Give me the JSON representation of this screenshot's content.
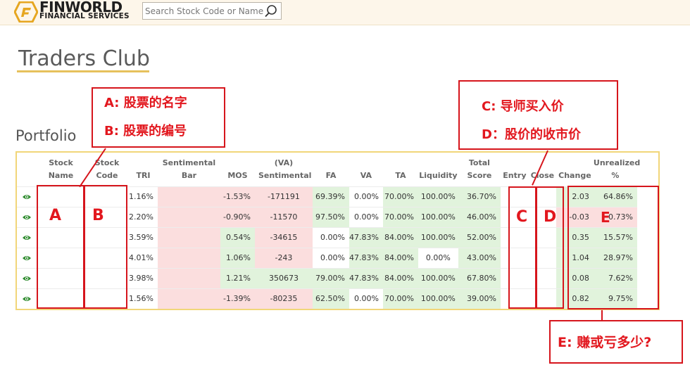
{
  "header": {
    "brand_name": "FINWORLD",
    "brand_sub": "FINANCIAL SERVICES",
    "search_placeholder": "Search Stock Code or Name",
    "logo_icon": "finworld-logo-icon",
    "search_icon": "search-icon"
  },
  "page_title": "Traders Club",
  "section_title": "Portfolio",
  "colors": {
    "accent": "#e6c15c",
    "negative_bg": "#fbdede",
    "positive_bg": "#e1f3dc",
    "annotation": "#e2171e",
    "eye": "#2e8b2e"
  },
  "table": {
    "columns": [
      "",
      "Stock Name",
      "Stock Code",
      "TRI",
      "Sentimental Bar",
      "MOS",
      "(VA) Sentimental",
      "FA",
      "VA",
      "TA",
      "Liquidity",
      "Total Score",
      "Entry",
      "Close",
      "Change",
      "Unrealized %"
    ],
    "rows": [
      {
        "tri": "1.16%",
        "mos": "-1.53%",
        "va_sent": "-171191",
        "fa": "69.39%",
        "va": "0.00%",
        "ta": "70.00%",
        "liq": "100.00%",
        "score": "36.70%",
        "change": "2.03",
        "unreal": "64.86%"
      },
      {
        "tri": "2.20%",
        "mos": "-0.90%",
        "va_sent": "-11570",
        "fa": "97.50%",
        "va": "0.00%",
        "ta": "70.00%",
        "liq": "100.00%",
        "score": "46.00%",
        "change": "-0.03",
        "unreal": "-0.73%"
      },
      {
        "tri": "3.59%",
        "mos": "0.54%",
        "va_sent": "-34615",
        "fa": "0.00%",
        "va": "47.83%",
        "ta": "84.00%",
        "liq": "100.00%",
        "score": "52.00%",
        "change": "0.35",
        "unreal": "15.57%"
      },
      {
        "tri": "4.01%",
        "mos": "1.06%",
        "va_sent": "-243",
        "fa": "0.00%",
        "va": "47.83%",
        "ta": "84.00%",
        "liq": "0.00%",
        "score": "43.00%",
        "change": "1.04",
        "unreal": "28.97%"
      },
      {
        "tri": "3.98%",
        "mos": "1.21%",
        "va_sent": "350673",
        "fa": "79.00%",
        "va": "47.83%",
        "ta": "84.00%",
        "liq": "100.00%",
        "score": "67.80%",
        "change": "0.08",
        "unreal": "7.62%"
      },
      {
        "tri": "1.56%",
        "mos": "-1.39%",
        "va_sent": "-80235",
        "fa": "62.50%",
        "va": "0.00%",
        "ta": "70.00%",
        "liq": "100.00%",
        "score": "39.00%",
        "change": "0.82",
        "unreal": "9.75%"
      }
    ]
  },
  "annotations": {
    "a_line1": "A: 股票的名字",
    "a_line2": "B: 股票的编号",
    "c_line1": "C: 导师买入价",
    "c_line2": "D：股价的收市价",
    "e_label": "E: 赚或亏多少?",
    "letter_a": "A",
    "letter_b": "B",
    "letter_c": "C",
    "letter_d": "D",
    "letter_e": "E"
  }
}
